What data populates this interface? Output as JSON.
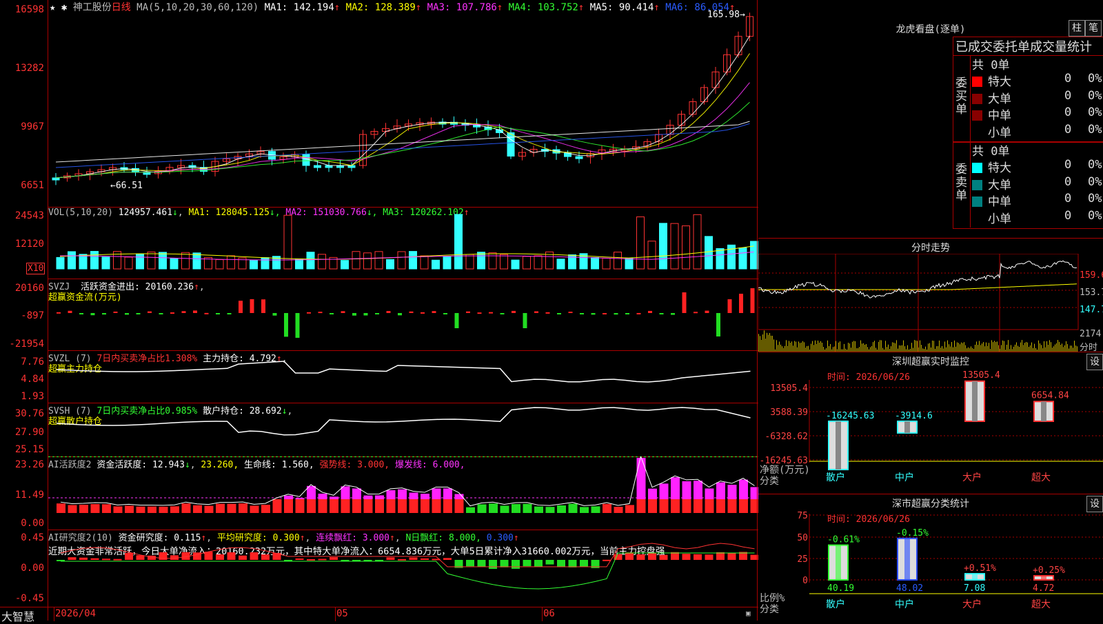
{
  "main": {
    "stock": "神工股份",
    "period": "日线",
    "ma_prefix": "MA(5,10,20,30,60,120)",
    "ma": [
      {
        "label": "MA1:",
        "value": "142.194",
        "color": "#ffffff"
      },
      {
        "label": "MA2:",
        "value": "128.389",
        "color": "#ffff00"
      },
      {
        "label": "MA3:",
        "value": "107.786",
        "color": "#ff33ff"
      },
      {
        "label": "MA4:",
        "value": "103.752",
        "color": "#33ff33"
      },
      {
        "label": "MA5:",
        "value": "90.414",
        "color": "#ffffff"
      },
      {
        "label": "MA6:",
        "value": "86.054",
        "color": "#2a5cff"
      }
    ],
    "axis": [
      "16598",
      "13282",
      "9967",
      "6651"
    ],
    "high_label": "165.98",
    "low_label": "66.51",
    "colors": {
      "up": "#ff3333",
      "down": "#33ffff"
    }
  },
  "vol": {
    "header": "VOL(5,10,20)",
    "value": "124957.461",
    "ma": [
      {
        "label": "MA1:",
        "value": "128045.125",
        "color": "#ffff00"
      },
      {
        "label": "MA2:",
        "value": "151030.766",
        "color": "#ff33ff"
      },
      {
        "label": "MA3:",
        "value": "120262.102",
        "color": "#33ff33"
      }
    ],
    "axis": [
      "24543",
      "12120"
    ],
    "unit": "X10"
  },
  "svzj": {
    "header": "SVZJ",
    "label": "活跃资金进出:",
    "value": "20160.236",
    "name": "超赢资金流(万元)",
    "axis": [
      "20160",
      "-897",
      "-21954"
    ]
  },
  "svzl": {
    "header": "SVZL (7)",
    "ratio_text": "7日内买卖净占比1.308%",
    "label": "主力持仓:",
    "value": "4.792",
    "name": "超赢主力持仓",
    "axis": [
      "7.76",
      "4.84",
      "1.93"
    ]
  },
  "svsh": {
    "header": "SVSH (7)",
    "ratio_text": "7日内买卖净占比0.985%",
    "label": "散户持仓:",
    "value": "28.692",
    "name": "超赢散户持仓",
    "axis": [
      "30.76",
      "27.90",
      "25.15"
    ]
  },
  "ai1": {
    "header": "AI活跃度2",
    "label": "资金活跃度:",
    "value": "12.943",
    "v2": "23.260,",
    "life_label": "生命线:",
    "life": "1.560,",
    "strong_label": "强势线:",
    "strong": "3.000,",
    "burst_label": "爆发线:",
    "burst": "6.000,",
    "axis": [
      "23.26",
      "11.49",
      "0.00"
    ]
  },
  "ai2": {
    "header": "AI研究度2(10)",
    "label": "资金研究度:",
    "value": "0.115",
    "avg_label": "平均研究度:",
    "avg": "0.300",
    "cont_label": "连续飘红:",
    "cont": "3.000",
    "n_label": "N日飘红:",
    "n": "8.000,",
    "last": "0.300",
    "comment": "近期大资金非常活跃，今日大单净流入：20160.232万元，其中特大单净流入：6654.836万元，大单5日累计净入31660.002万元，当前主力控盘强",
    "axis": [
      "0.45",
      "0.00",
      "-0.45"
    ]
  },
  "bottom": {
    "brand": "大智慧",
    "dates": [
      "2026/04",
      "05",
      "06"
    ]
  },
  "right": {
    "lhkp": {
      "title": "龙虎看盘(逐单)",
      "btn1": "柱",
      "btn2": "笔",
      "tabs": "已成交委托单成交量统计",
      "buy_side": "委买单",
      "sell_side": "委卖单",
      "buy_total": "共 0单",
      "sell_total": "共 0单",
      "buy_rows": [
        {
          "name": "特大",
          "count": "0",
          "pct": "0%",
          "color": "#ff0000"
        },
        {
          "name": "大单",
          "count": "0",
          "pct": "0%",
          "color": "#880000"
        },
        {
          "name": "中单",
          "count": "0",
          "pct": "0%",
          "color": "#880000"
        },
        {
          "name": "小单",
          "count": "0",
          "pct": "0%",
          "color": ""
        }
      ],
      "sell_rows": [
        {
          "name": "特大",
          "count": "0",
          "pct": "0%",
          "color": "#00ffff"
        },
        {
          "name": "大单",
          "count": "0",
          "pct": "0%",
          "color": "#008080"
        },
        {
          "name": "中单",
          "count": "0",
          "pct": "0%",
          "color": "#008080"
        },
        {
          "name": "小单",
          "count": "0",
          "pct": "0%",
          "color": ""
        }
      ]
    },
    "fszs": {
      "title": "分时走势",
      "prices": [
        "159.6",
        "153.7",
        "147.7"
      ],
      "vol": "2174",
      "unit": "分时"
    },
    "monitor": {
      "title": "深圳超赢实时监控",
      "btn": "设",
      "time": "时间: 2026/06/26",
      "axis": [
        "13505.4",
        "3588.39",
        "-6328.62",
        "-16245.63"
      ],
      "unit_line1": "净额(万元)",
      "unit_line2": "分类",
      "values": [
        "-16245.63",
        "-3914.6",
        "13505.4",
        "6654.84"
      ],
      "categories": [
        "散户",
        "中户",
        "大户",
        "超大"
      ]
    },
    "classify": {
      "title": "深市超赢分类统计",
      "btn": "设",
      "time": "时间: 2026/06/26",
      "axis": [
        "75",
        "50",
        "25",
        "0"
      ],
      "pct_labels": [
        "-0.61%",
        "-0.15%",
        "+0.51%",
        "+0.25%"
      ],
      "values": [
        "40.19",
        "48.02",
        "7.08",
        "4.72"
      ],
      "unit_line1": "比例%",
      "unit_line2": "分类",
      "categories": [
        "散户",
        "中户",
        "大户",
        "超大"
      ]
    }
  }
}
